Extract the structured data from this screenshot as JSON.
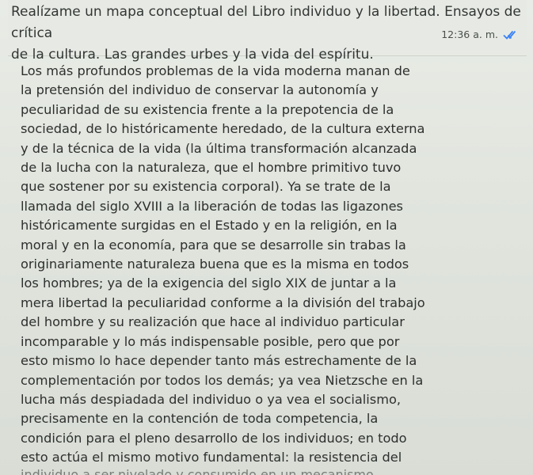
{
  "message": {
    "text": "Realízame un mapa conceptual del  Libro individuo y la libertad. Ensayos de crítica\nde la cultura. Las grandes urbes y la vida del espíritu.",
    "time": "12:36 a. m.",
    "status_icon": "double-check-icon",
    "tick_color": "#3b82f6"
  },
  "content": {
    "paragraph": "Los más profundos problemas de la vida moderna manan de\nla pretensión del individuo de conservar la autonomía y\npeculiaridad de su existencia frente a la prepotencia de la\nsociedad, de lo históricamente heredado, de la cultura externa\ny de la técnica de la vida (la última transformación alcanzada\nde la lucha con la naturaleza, que el hombre primitivo tuvo\nque sostener por su existencia corporal). Ya se trate de la\nllamada del siglo XVIII a la liberación de todas las ligazones\nhistóricamente surgidas en el Estado y en la religión, en la\nmoral y en la economía, para que se desarrolle sin trabas la\noriginariamente naturaleza buena que es la misma en todos\nlos hombres; ya de la exigencia del siglo XIX de juntar a la\nmera libertad la peculiaridad conforme a la división del trabajo\ndel hombre y su realización que hace al individuo particular\nincomparable y lo más indispensable posible, pero que por\nesto mismo lo hace depender tanto más estrechamente de la\ncomplementación por todos los demás; ya vea Nietzsche en la\nlucha más despiadada del individuo o ya vea el socialismo,\nprecisamente en la contención de toda competencia, la\ncondición para el pleno desarrollo de los individuos; en todo\nesto actúa el mismo motivo fundamental: la resistencia del",
    "cut_line": "individuo a ser nivelado y consumido en un mecanismo"
  }
}
